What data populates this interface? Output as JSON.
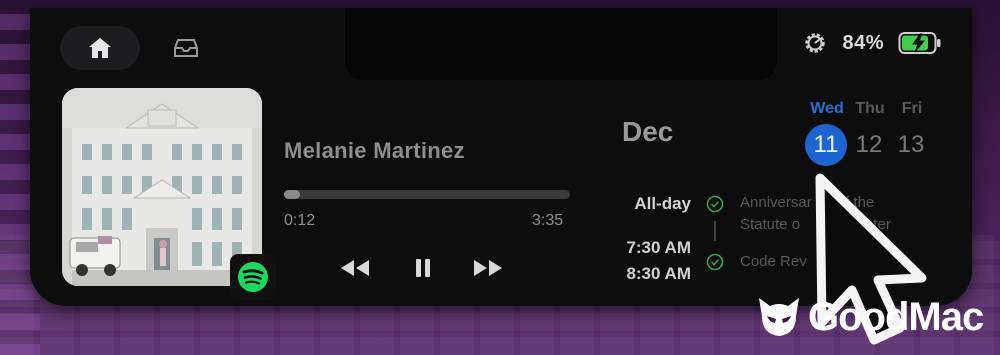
{
  "nav": {
    "home_icon": "home-icon",
    "tray_icon": "tray-icon"
  },
  "status": {
    "settings_icon": "gear-icon",
    "battery_percent": "84%",
    "battery_level": 0.84,
    "battery_color": "#3ecf4a",
    "charging": true
  },
  "player": {
    "artist": "Melanie Martinez",
    "elapsed": "0:12",
    "duration": "3:35",
    "progress": 0.056,
    "source_icon": "spotify-icon",
    "controls": {
      "rewind_icon": "rewind-icon",
      "pause_icon": "pause-icon",
      "forward_icon": "fast-forward-icon"
    }
  },
  "calendar": {
    "month": "Dec",
    "accent": "#1d64d0",
    "days": [
      {
        "name": "Wed",
        "date": "11",
        "selected": true
      },
      {
        "name": "Thu",
        "date": "12",
        "selected": false
      },
      {
        "name": "Fri",
        "date": "13",
        "selected": false
      }
    ],
    "events": [
      {
        "time": "All-day",
        "title": "Anniversary of the Statute of Westminster",
        "title_visible_line1": "Anniversar",
        "title_visible_line1b": "of the",
        "title_visible_line2": "Statute o",
        "title_visible_line2b": "minster"
      },
      {
        "time": "7:30 AM",
        "time2": "8:30 AM",
        "title": "Code Rev"
      }
    ]
  },
  "watermark": {
    "text": "GoodMac"
  }
}
